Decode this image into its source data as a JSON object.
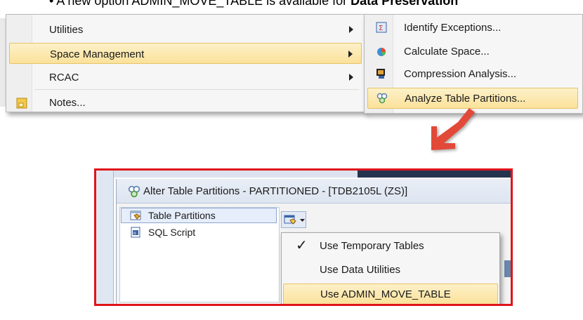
{
  "top_text": {
    "before": "• A new option ADMIN_MOVE_TABLE is available for ",
    "bold": "Data Preservation"
  },
  "context_menu": {
    "items": [
      {
        "label": "Utilities",
        "has_submenu": true,
        "selected": false
      },
      {
        "label": "Space Management",
        "has_submenu": true,
        "selected": true
      },
      {
        "label": "RCAC",
        "has_submenu": true,
        "selected": false
      },
      {
        "label": "Notes...",
        "has_submenu": false,
        "selected": false,
        "icon": "notes-icon"
      }
    ]
  },
  "space_submenu": {
    "items": [
      {
        "label": "Identify Exceptions...",
        "icon": "identify-exceptions-icon",
        "selected": false
      },
      {
        "label": "Calculate Space...",
        "icon": "pie-chart-icon",
        "selected": false
      },
      {
        "label": "Compression Analysis...",
        "icon": "compression-icon",
        "selected": false
      },
      {
        "label": "Analyze Table Partitions...",
        "icon": "partitions-icon",
        "selected": true
      }
    ]
  },
  "dialog": {
    "title": "Alter Table Partitions - PARTITIONED - [TDB2105L (ZS)]",
    "tree": [
      {
        "label": "Table Partitions",
        "icon": "table-partitions-icon",
        "selected": true
      },
      {
        "label": "SQL Script",
        "icon": "sql-script-icon",
        "selected": false
      }
    ],
    "options_menu": {
      "items": [
        {
          "label": "Use Temporary Tables",
          "checked": true,
          "selected": false
        },
        {
          "label": "Use Data Utilities",
          "checked": false,
          "selected": false
        },
        {
          "label": "Use ADMIN_MOVE_TABLE",
          "checked": false,
          "selected": true
        }
      ],
      "check_glyph": "✓"
    }
  },
  "colors": {
    "highlight": "#fbe19a",
    "callout_border": "#e0141a",
    "arrow": "#e0141a"
  }
}
